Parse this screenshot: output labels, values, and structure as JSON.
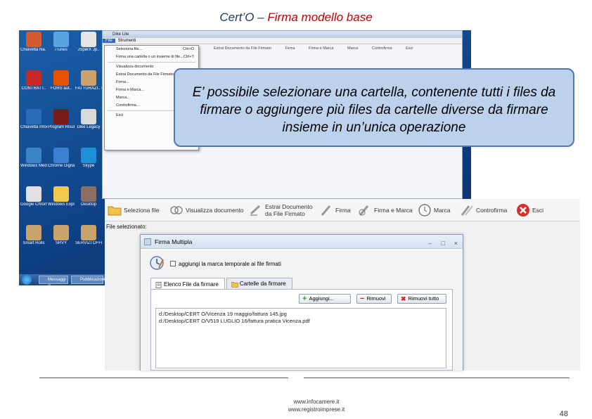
{
  "slide": {
    "title_part1": "Cert’O – ",
    "title_part2": "Firma modello base",
    "callout_text": "E’ possibile selezionare una cartella, contenente tutti i  files da firmare o aggiungere più files da cartelle diverse da firmare insieme in un’unica operazione",
    "footer_url1": "www.infocamere.it",
    "footer_url2": "www.registroimprese.it",
    "page_number": "48"
  },
  "desktop": {
    "icons": [
      {
        "label": "Chiavetta Na. Stella",
        "color": "#d65a31",
        "icon": "folder-icon"
      },
      {
        "label": "iTunes",
        "color": "#5aa5e0",
        "icon": "music-icon"
      },
      {
        "label": "JSperX Jp..",
        "color": "#e6e6e6",
        "icon": "document-icon"
      },
      {
        "label": "CONTRATT..",
        "color": "#c62828",
        "icon": "pdf-icon"
      },
      {
        "label": "FORS aut..",
        "color": "#e65100",
        "icon": "app-icon"
      },
      {
        "label": "FATTURAZI.. ELETTRONI..",
        "color": "#c9a36b",
        "icon": "folder-icon"
      },
      {
        "label": "Chiavetta Infocert",
        "color": "#2a6db5",
        "icon": "usb-icon"
      },
      {
        "label": "Program Risultati..",
        "color": "#7a1a1a",
        "icon": "app-icon"
      },
      {
        "label": "Dike Legacy",
        "color": "#d9d9d9",
        "icon": "usb-icon"
      },
      {
        "label": "Windows Media Player",
        "color": "#3b83c7",
        "icon": "media-icon"
      },
      {
        "label": "Chrome Digitale",
        "color": "#3b7fd0",
        "icon": "app-icon"
      },
      {
        "label": "Skype",
        "color": "#1e90d8",
        "icon": "skype-icon"
      },
      {
        "label": "Google Chrome",
        "color": "#e0e0e0",
        "icon": "chrome-icon"
      },
      {
        "label": "Windows Explorer",
        "color": "#f2c94c",
        "icon": "app-icon"
      },
      {
        "label": "Desktop",
        "color": "#8d6e63",
        "icon": "app-icon"
      },
      {
        "label": "Smart Rolls",
        "color": "#c9a36b",
        "icon": "folder-icon"
      },
      {
        "label": "SRVY",
        "color": "#c9a36b",
        "icon": "folder-icon"
      },
      {
        "label": "SERVIZI OFFERTE",
        "color": "#c9a36b",
        "icon": "folder-icon"
      }
    ],
    "taskbar_items": [
      "Messaggi C..",
      "Pubblicazioni"
    ]
  },
  "dike_window": {
    "title": "Dike Lite",
    "menu": [
      "File",
      "Strumenti"
    ],
    "file_menu_items": [
      {
        "label": "Seleziona file...",
        "shortcut": "Ctrl+O"
      },
      {
        "label": "Firma una cartella o un insieme di file...",
        "shortcut": "Ctrl+T"
      },
      {
        "label": "Visualizza documento",
        "shortcut": ""
      },
      {
        "label": "Estrai Documento da File Firmato",
        "shortcut": ""
      },
      {
        "label": "Firma...",
        "shortcut": ""
      },
      {
        "label": "Firma e Marca...",
        "shortcut": ""
      },
      {
        "label": "Marca...",
        "shortcut": ""
      },
      {
        "label": "Controfirma...",
        "shortcut": ""
      },
      {
        "label": "Esci",
        "shortcut": ""
      }
    ],
    "small_toolbar": [
      "Estrai Documento da File Firmato",
      "Firma",
      "Firma e Marca",
      "Marca",
      "Controfirma",
      "Esci"
    ]
  },
  "toolbar": {
    "seleziona": "Seleziona file",
    "visualizza": "Visualizza documento",
    "estrai_line1": "Estrai Documento",
    "estrai_line2": "da File Firmato",
    "firma": "Firma",
    "firma_marca": "Firma e Marca",
    "marca": "Marca",
    "controfirma": "Controfirma",
    "esci": "Esci",
    "file_selezionato": "File selezionato:"
  },
  "dialog": {
    "title": "Firma Multipla",
    "controls": [
      "–",
      "□",
      "×"
    ],
    "checkbox_label": "aggiungi la marca temporale ai file firmati",
    "checkbox_checked": false,
    "tab_files": "Elenco File da firmare",
    "tab_folders": "Cartelle da firmare",
    "btn_add": "Aggiungi...",
    "btn_remove": "Rimuovi",
    "btn_remove_all": "Rimuovi tutto",
    "files": [
      "d:/Desktop/CERT O/Vicenza 19 maggio/fattura 145.jpg",
      "d:/Desktop/CERT O/V519 LUGLIO 16/fattura pratica Vicenza.pdf"
    ]
  }
}
